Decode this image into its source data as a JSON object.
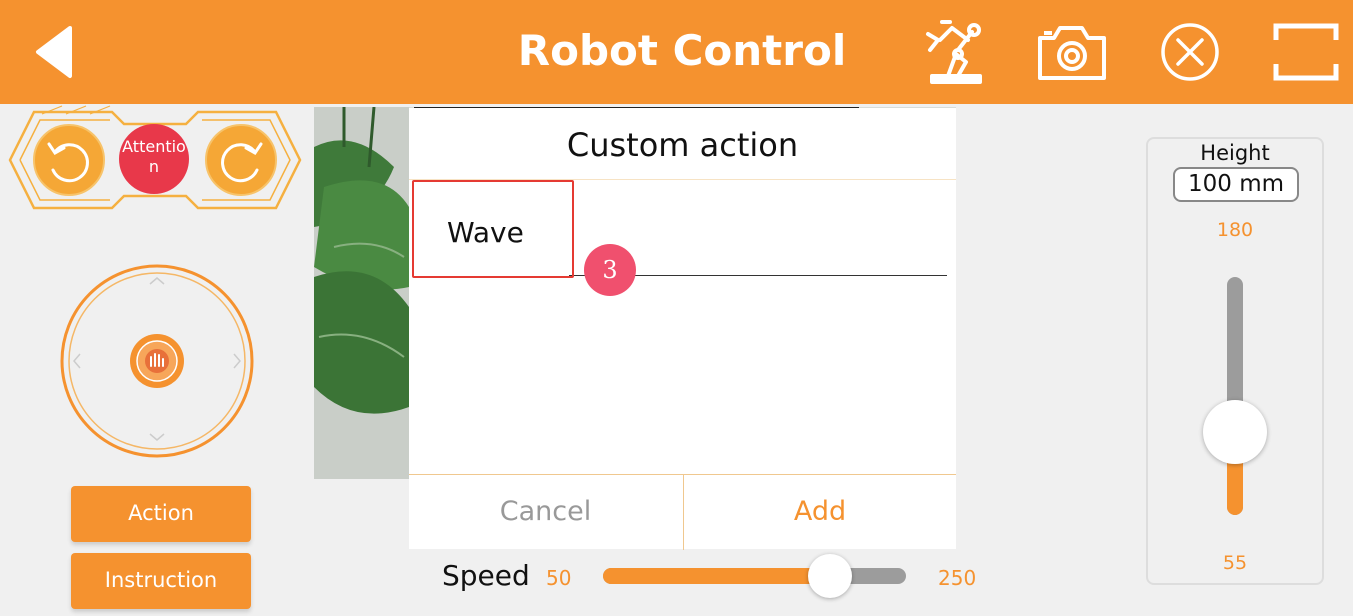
{
  "header": {
    "title": "Robot Control",
    "back_icon": "back-arrow-icon",
    "icons": [
      "robot-arm-icon",
      "camera-icon",
      "close-circle-icon",
      "fullscreen-icon"
    ]
  },
  "left_panel": {
    "attention_label": "Attention",
    "rotate_left_icon": "rotate-left-icon",
    "rotate_right_icon": "rotate-right-icon",
    "action_label": "Action",
    "instruction_label": "Instruction"
  },
  "dialog": {
    "title": "Custom action",
    "input_value": "Wave",
    "step_number": "3",
    "cancel_label": "Cancel",
    "add_label": "Add"
  },
  "speed": {
    "label": "Speed",
    "min": "50",
    "max": "250",
    "fraction": 0.75
  },
  "height": {
    "label": "Height",
    "value": "100 mm",
    "max": "180",
    "min": "55",
    "fraction": 0.35
  },
  "colors": {
    "accent": "#f5922f",
    "attention": "#e8384a",
    "badge": "#f0506e",
    "highlight": "#e53a32"
  }
}
